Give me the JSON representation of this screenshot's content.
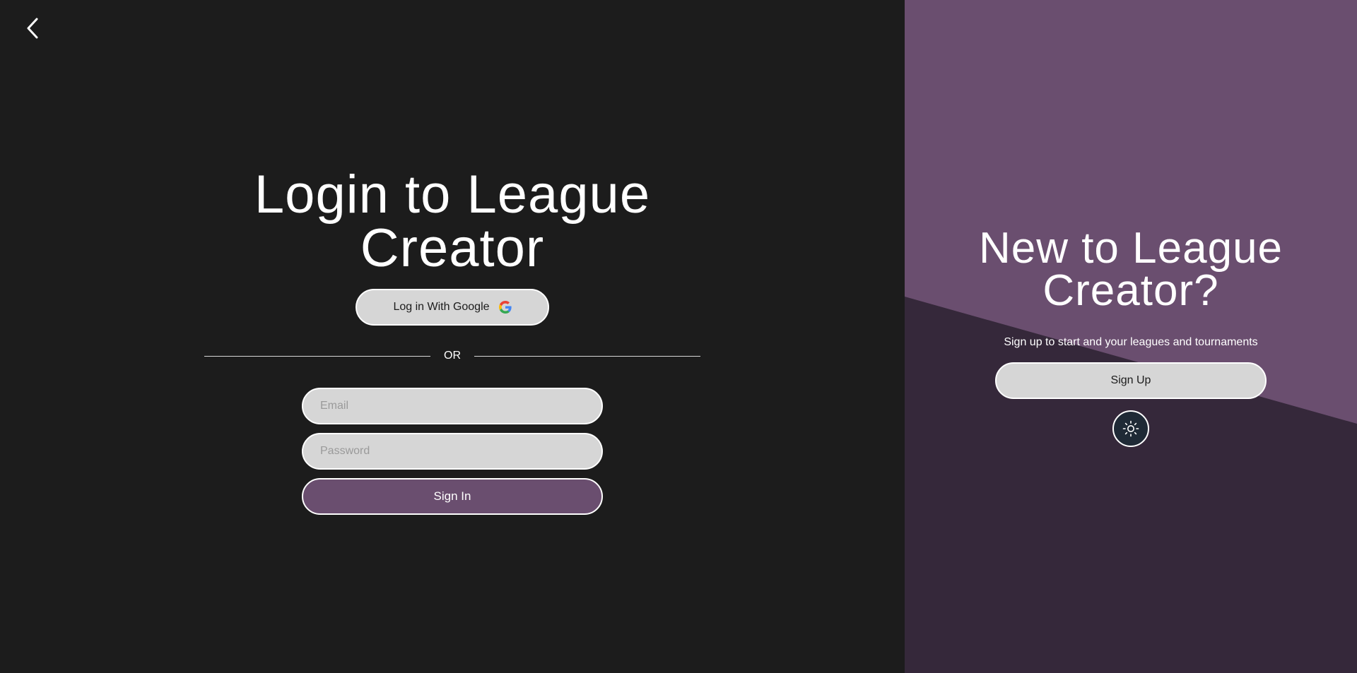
{
  "nav": {
    "back_icon": "chevron-left-icon"
  },
  "login": {
    "title": "Login to League Creator",
    "google_button_label": "Log in With Google",
    "google_icon": "google-g-icon",
    "divider_label": "OR",
    "email_placeholder": "Email",
    "password_placeholder": "Password",
    "signin_label": "Sign In"
  },
  "signup": {
    "title": "New to League Creator?",
    "subtitle": "Sign up to start and your leagues and tournaments",
    "button_label": "Sign Up",
    "theme_toggle_icon": "sun-icon"
  },
  "colors": {
    "left_background": "#1c1c1c",
    "accent_purple": "#6a4e6f",
    "dark_purple": "#35283a",
    "button_light": "#d6d6d6",
    "toggle_background": "#1f2a36"
  }
}
